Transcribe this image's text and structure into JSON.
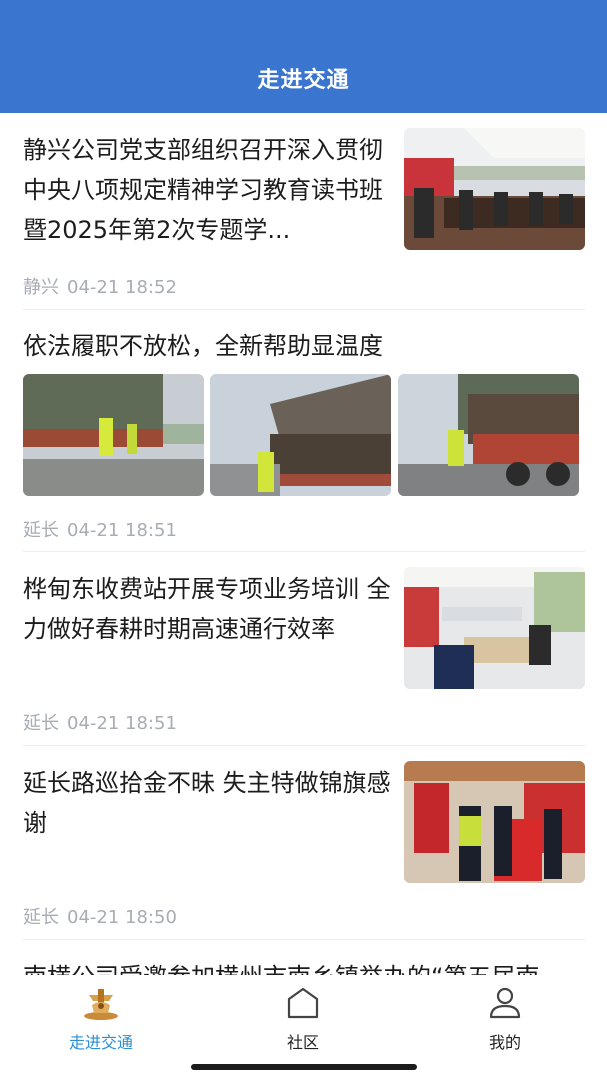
{
  "header": {
    "title": "走进交通"
  },
  "articles": [
    {
      "title": "静兴公司党支部组织召开深入贯彻中央八项规定精神学习教育读书班暨2025年第2次专题学...",
      "source": "静兴",
      "time": "04-21 18:52"
    },
    {
      "title": "依法履职不放松，全新帮助显温度",
      "source": "延长",
      "time": "04-21 18:51"
    },
    {
      "title": "桦甸东收费站开展专项业务培训 全力做好春耕时期高速通行效率",
      "source": "延长",
      "time": "04-21 18:51"
    },
    {
      "title": "延长路巡拾金不昧 失主特做锦旗感谢",
      "source": "延长",
      "time": "04-21 18:50"
    },
    {
      "title": "南横公司受邀参加横州市南乡镇举办的“第五届南"
    }
  ],
  "tabbar": {
    "items": [
      {
        "label": "走进交通",
        "icon": "emblem-icon",
        "active": true
      },
      {
        "label": "社区",
        "icon": "home-icon",
        "active": false
      },
      {
        "label": "我的",
        "icon": "user-icon",
        "active": false
      }
    ],
    "active_color": "#2a8fd6"
  },
  "colors": {
    "header": "#3a76d0",
    "meta": "#a8adb4"
  }
}
